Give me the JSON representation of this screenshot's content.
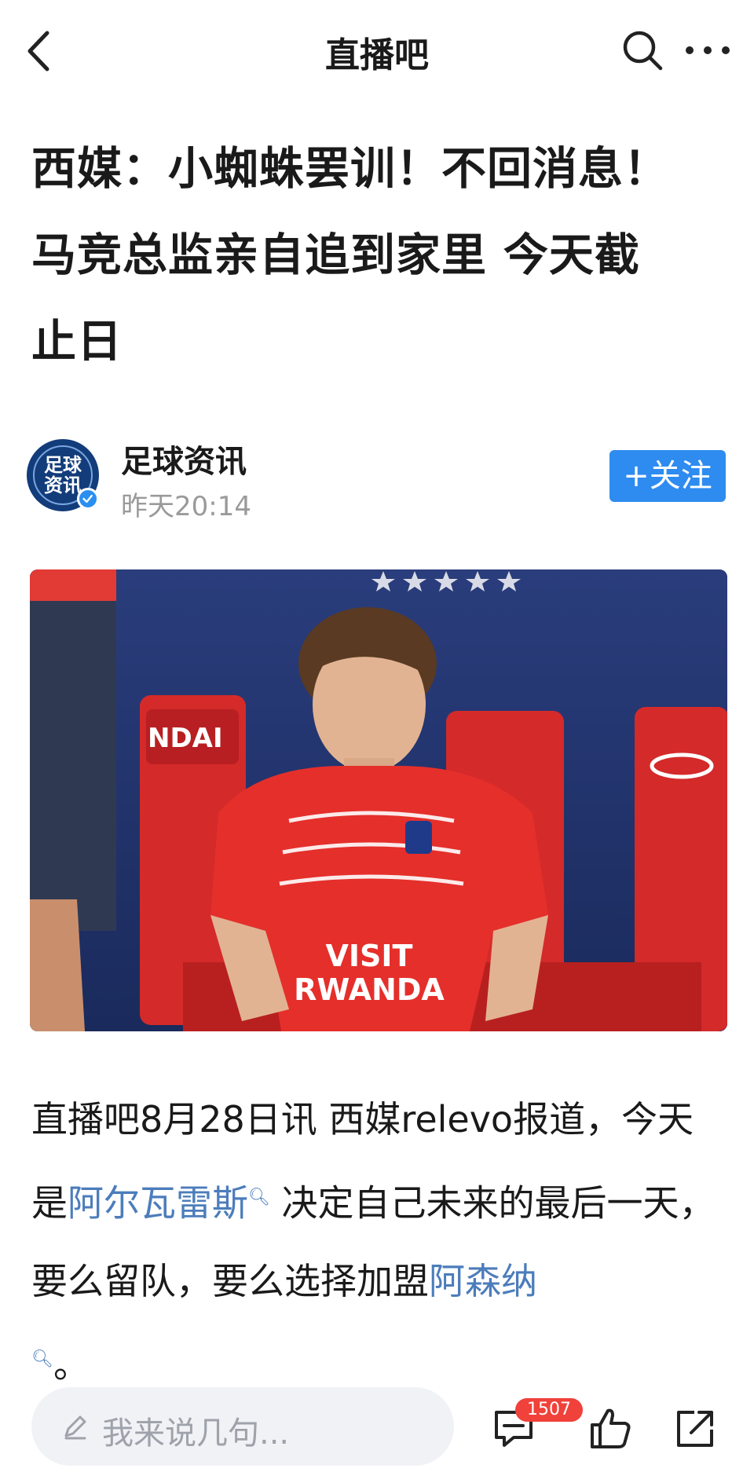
{
  "nav": {
    "title": "直播吧"
  },
  "article": {
    "headline_lines": [
      "西媒：小蜘蛛罢训！不回消息！",
      "马竞总监亲自追到家里 今天截",
      "止日"
    ],
    "author": {
      "name": "足球资讯",
      "avatar_text": [
        "足球",
        "资讯"
      ],
      "time": "昨天20:14",
      "follow_label": "+关注"
    },
    "photo": {
      "shirt_text": [
        "VISIT",
        "RWANDA"
      ],
      "seat_text": "NDAI"
    },
    "body": {
      "p1": "直播吧8月28日讯 西媒relevo报道，今天是",
      "link1": "阿尔瓦雷斯",
      "p2": " 决定自己未来的最后一天，要么留队，要么选择加盟",
      "link2": "阿森纳",
      "p3": "。"
    }
  },
  "bottom": {
    "comment_placeholder": "我来说几句...",
    "comment_count": "1507"
  },
  "colors": {
    "accent": "#2e8cf0",
    "link": "#4c7dbb",
    "badge": "#f0413a"
  },
  "icons": [
    "back-icon",
    "search-icon",
    "more-icon",
    "pen-icon",
    "comment-icon",
    "like-icon",
    "share-icon",
    "verified-icon"
  ]
}
